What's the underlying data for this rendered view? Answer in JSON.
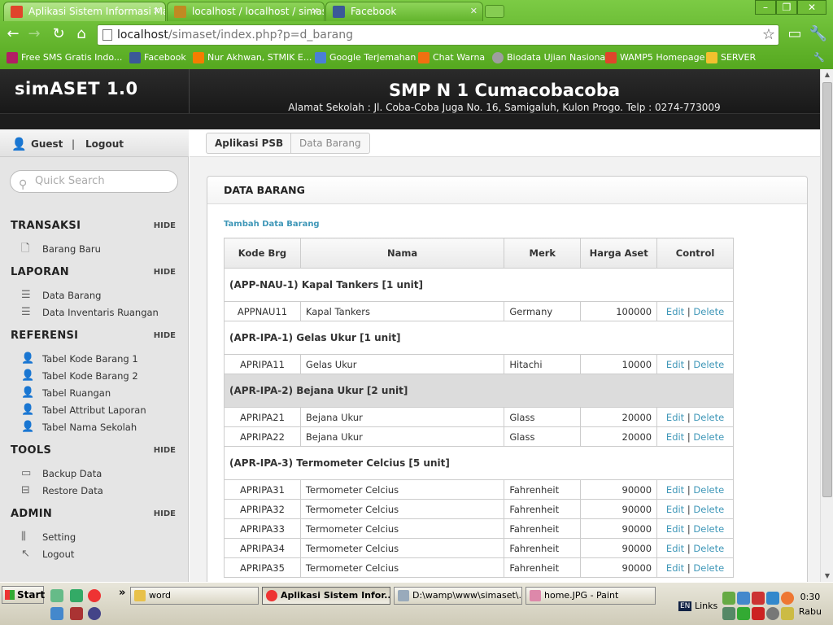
{
  "browser": {
    "tabs": [
      {
        "title": "Aplikasi Sistem Informasi Mana",
        "color": "#e0452b"
      },
      {
        "title": "localhost / localhost / simaset /",
        "color": "#c08a22"
      },
      {
        "title": "Facebook",
        "color": "#3b5998"
      }
    ],
    "url_lead": "localhost",
    "url_rest": "/simaset/index.php?p=d_barang",
    "bookmarks": [
      {
        "label": "Free SMS Gratis Indo...",
        "color": "#b21e64"
      },
      {
        "label": "Facebook",
        "color": "#3b5998"
      },
      {
        "label": "Nur Akhwan, STMIK E...",
        "color": "#f57d00"
      },
      {
        "label": "Google Terjemahan",
        "color": "#4a7fd6"
      },
      {
        "label": "Chat Warna",
        "color": "#f07010"
      },
      {
        "label": "Biodata Ujian Nasional",
        "color": "#9e9e9e"
      },
      {
        "label": "WAMP5 Homepage",
        "color": "#e0452b"
      },
      {
        "label": "SERVER",
        "color": "#f2c12e"
      }
    ]
  },
  "header": {
    "brand": "simASET 1.0",
    "school": "SMP N 1 Cumacobacoba",
    "address": "Alamat Sekolah : Jl. Coba-Coba Juga No. 16, Samigaluh, Kulon Progo. Telp : 0274-773009"
  },
  "sidebar": {
    "user": "Guest",
    "sep": "|",
    "logout": "Logout",
    "search_placeholder": "Quick Search",
    "hide_label": "HIDE",
    "sections": [
      {
        "title": "TRANSAKSI",
        "items": [
          "Barang Baru"
        ]
      },
      {
        "title": "LAPORAN",
        "items": [
          "Data Barang",
          "Data Inventaris Ruangan"
        ]
      },
      {
        "title": "REFERENSI",
        "items": [
          "Tabel Kode Barang 1",
          "Tabel Kode Barang 2",
          "Tabel Ruangan",
          "Tabel Attribut Laporan",
          "Tabel Nama Sekolah"
        ]
      },
      {
        "title": "TOOLS",
        "items": [
          "Backup Data",
          "Restore Data"
        ]
      },
      {
        "title": "ADMIN",
        "items": [
          "Setting",
          "Logout"
        ]
      }
    ]
  },
  "main": {
    "breadcrumb": [
      "Aplikasi PSB",
      "Data Barang"
    ],
    "panel_title": "DATA BARANG",
    "add_link": "Tambah Data Barang",
    "columns": [
      "Kode Brg",
      "Nama",
      "Merk",
      "Harga Aset",
      "Control"
    ],
    "edit_label": "Edit",
    "delete_label": "Delete",
    "link_sep": "|",
    "groups": [
      {
        "title": "(APP-NAU-1) Kapal Tankers [1 unit]",
        "alt": false,
        "rows": [
          {
            "kode": "APPNAU11",
            "nama": "Kapal Tankers",
            "merk": "Germany",
            "harga": "100000"
          }
        ]
      },
      {
        "title": "(APR-IPA-1) Gelas Ukur [1 unit]",
        "alt": false,
        "rows": [
          {
            "kode": "APRIPA11",
            "nama": "Gelas Ukur",
            "merk": "Hitachi",
            "harga": "10000"
          }
        ]
      },
      {
        "title": "(APR-IPA-2) Bejana Ukur [2 unit]",
        "alt": true,
        "rows": [
          {
            "kode": "APRIPA21",
            "nama": "Bejana Ukur",
            "merk": "Glass",
            "harga": "20000"
          },
          {
            "kode": "APRIPA22",
            "nama": "Bejana Ukur",
            "merk": "Glass",
            "harga": "20000"
          }
        ]
      },
      {
        "title": "(APR-IPA-3) Termometer Celcius [5 unit]",
        "alt": false,
        "rows": [
          {
            "kode": "APRIPA31",
            "nama": "Termometer Celcius",
            "merk": "Fahrenheit",
            "harga": "90000"
          },
          {
            "kode": "APRIPA32",
            "nama": "Termometer Celcius",
            "merk": "Fahrenheit",
            "harga": "90000"
          },
          {
            "kode": "APRIPA33",
            "nama": "Termometer Celcius",
            "merk": "Fahrenheit",
            "harga": "90000"
          },
          {
            "kode": "APRIPA34",
            "nama": "Termometer Celcius",
            "merk": "Fahrenheit",
            "harga": "90000"
          },
          {
            "kode": "APRIPA35",
            "nama": "Termometer Celcius",
            "merk": "Fahrenheit",
            "harga": "90000"
          }
        ]
      }
    ]
  },
  "taskbar": {
    "start": "Start",
    "more": "»",
    "buttons": [
      {
        "label": "word",
        "active": false
      },
      {
        "label": "Aplikasi Sistem Infor...",
        "active": true
      },
      {
        "label": "D:\\wamp\\www\\simaset\\...",
        "active": false
      },
      {
        "label": "home.JPG - Paint",
        "active": false
      }
    ],
    "lang": "EN",
    "links": "Links",
    "time": "0:30",
    "day": "Rabu"
  }
}
